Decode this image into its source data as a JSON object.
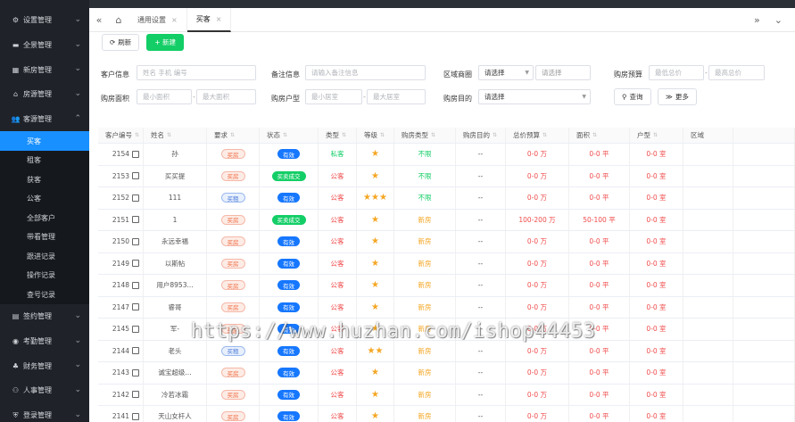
{
  "sidebar": {
    "menus": [
      {
        "label": "设置管理",
        "icon": "gear-icon"
      },
      {
        "label": "全景管理",
        "icon": "panorama-icon"
      },
      {
        "label": "新房管理",
        "icon": "building-icon"
      },
      {
        "label": "房源管理",
        "icon": "home-icon"
      },
      {
        "label": "客源管理",
        "icon": "users-icon"
      }
    ],
    "submenu": [
      "买客",
      "租客",
      "获客",
      "公客",
      "全部客户",
      "带看管理",
      "跟进记录",
      "操作记录",
      "查号记录"
    ],
    "menus_bottom": [
      {
        "label": "签约管理",
        "icon": "contract-icon"
      },
      {
        "label": "考勤管理",
        "icon": "location-icon"
      },
      {
        "label": "财务管理",
        "icon": "finance-icon"
      },
      {
        "label": "人事管理",
        "icon": "org-icon"
      },
      {
        "label": "登录管理",
        "icon": "shield-icon"
      }
    ]
  },
  "tabs": [
    {
      "label": "通用设置",
      "close": "×"
    },
    {
      "label": "买客",
      "close": "×"
    }
  ],
  "toolbar": {
    "refresh_label": "刷新",
    "new_label": "+ 新建"
  },
  "filters": {
    "customer_info_label": "客户信息",
    "customer_info_placeholder": "姓名 手机 编号",
    "remark_label": "备注信息",
    "remark_placeholder": "请输入备注信息",
    "area_label": "区域商圈",
    "area_select1": "请选择",
    "area_select2": "请选择",
    "budget_label": "购房预算",
    "budget_min_placeholder": "最低总价",
    "budget_max_placeholder": "最高总价",
    "size_label": "购房面积",
    "size_min_placeholder": "最小面积",
    "size_max_placeholder": "最大面积",
    "layout_label": "购房户型",
    "layout_min_placeholder": "最小居室",
    "layout_max_placeholder": "最大居室",
    "purpose_label": "购房目的",
    "purpose_select": "请选择",
    "search_label": "查询",
    "more_label": "更多",
    "range_dash": "-"
  },
  "table": {
    "headers": [
      "客户编号",
      "姓名",
      "要求",
      "状态",
      "类型",
      "等级",
      "购房类型",
      "购房目的",
      "总价预算",
      "面积",
      "户型",
      "区域"
    ],
    "rows": [
      {
        "id": "2154",
        "name": "孙",
        "req": "买房",
        "req_type": "buy",
        "status": "有效",
        "status_type": "valid",
        "type": "私客",
        "type_class": "green",
        "stars": "★",
        "house_type": "不限",
        "house_class": "green",
        "purpose": "--",
        "budget": "0-0 万",
        "area": "0-0 平",
        "layout": "0-0 室",
        "region": ""
      },
      {
        "id": "2153",
        "name": "买买提",
        "req": "买房",
        "req_type": "buy",
        "status": "买卖成交",
        "status_type": "done",
        "type": "公客",
        "type_class": "red",
        "stars": "★",
        "house_type": "不限",
        "house_class": "green",
        "purpose": "--",
        "budget": "0-0 万",
        "area": "0-0 平",
        "layout": "0-0 室",
        "region": ""
      },
      {
        "id": "2152",
        "name": "111",
        "req": "买租",
        "req_type": "rent",
        "status": "有效",
        "status_type": "valid",
        "type": "公客",
        "type_class": "red",
        "stars": "★★★",
        "house_type": "不限",
        "house_class": "green",
        "purpose": "--",
        "budget": "0-0 万",
        "area": "0-0 平",
        "layout": "0-0 室",
        "region": ""
      },
      {
        "id": "2151",
        "name": "1",
        "req": "买房",
        "req_type": "buy",
        "status": "买卖成交",
        "status_type": "done",
        "type": "公客",
        "type_class": "red",
        "stars": "★",
        "house_type": "新房",
        "house_class": "orange",
        "purpose": "--",
        "budget": "100-200 万",
        "area": "50-100 平",
        "layout": "0-0 室",
        "region": ""
      },
      {
        "id": "2150",
        "name": "永远幸福",
        "req": "买房",
        "req_type": "buy",
        "status": "有效",
        "status_type": "valid",
        "type": "公客",
        "type_class": "red",
        "stars": "★",
        "house_type": "新房",
        "house_class": "orange",
        "purpose": "--",
        "budget": "0-0 万",
        "area": "0-0 平",
        "layout": "0-0 室",
        "region": ""
      },
      {
        "id": "2149",
        "name": "以斯帖",
        "req": "买房",
        "req_type": "buy",
        "status": "有效",
        "status_type": "valid",
        "type": "公客",
        "type_class": "red",
        "stars": "★",
        "house_type": "新房",
        "house_class": "orange",
        "purpose": "--",
        "budget": "0-0 万",
        "area": "0-0 平",
        "layout": "0-0 室",
        "region": ""
      },
      {
        "id": "2148",
        "name": "用户8953...",
        "req": "买房",
        "req_type": "buy",
        "status": "有效",
        "status_type": "valid",
        "type": "公客",
        "type_class": "red",
        "stars": "★",
        "house_type": "新房",
        "house_class": "orange",
        "purpose": "--",
        "budget": "0-0 万",
        "area": "0-0 平",
        "layout": "0-0 室",
        "region": ""
      },
      {
        "id": "2147",
        "name": "睿哥",
        "req": "买房",
        "req_type": "buy",
        "status": "有效",
        "status_type": "valid",
        "type": "公客",
        "type_class": "red",
        "stars": "★",
        "house_type": "新房",
        "house_class": "orange",
        "purpose": "--",
        "budget": "0-0 万",
        "area": "0-0 平",
        "layout": "0-0 室",
        "region": ""
      },
      {
        "id": "2145",
        "name": "军-",
        "req": "买房",
        "req_type": "buy",
        "status": "有效",
        "status_type": "valid",
        "type": "公客",
        "type_class": "red",
        "stars": "★",
        "house_type": "新房",
        "house_class": "orange",
        "purpose": "--",
        "budget": "0-0 万",
        "area": "0-0 平",
        "layout": "0-0 室",
        "region": ""
      },
      {
        "id": "2144",
        "name": "老头",
        "req": "买租",
        "req_type": "rent",
        "status": "有效",
        "status_type": "valid",
        "type": "公客",
        "type_class": "red",
        "stars": "★★",
        "house_type": "新房",
        "house_class": "orange",
        "purpose": "--",
        "budget": "0-0 万",
        "area": "0-0 平",
        "layout": "0-0 室",
        "region": ""
      },
      {
        "id": "2143",
        "name": "诚宝超级...",
        "req": "买房",
        "req_type": "buy",
        "status": "有效",
        "status_type": "valid",
        "type": "公客",
        "type_class": "red",
        "stars": "★",
        "house_type": "新房",
        "house_class": "orange",
        "purpose": "--",
        "budget": "0-0 万",
        "area": "0-0 平",
        "layout": "0-0 室",
        "region": ""
      },
      {
        "id": "2142",
        "name": "冷若冰霜",
        "req": "买房",
        "req_type": "buy",
        "status": "有效",
        "status_type": "valid",
        "type": "公客",
        "type_class": "red",
        "stars": "★",
        "house_type": "新房",
        "house_class": "orange",
        "purpose": "--",
        "budget": "0-0 万",
        "area": "0-0 平",
        "layout": "0-0 室",
        "region": ""
      },
      {
        "id": "2141",
        "name": "天山女杆人",
        "req": "买房",
        "req_type": "buy",
        "status": "有效",
        "status_type": "valid",
        "type": "公客",
        "type_class": "red",
        "stars": "★",
        "house_type": "新房",
        "house_class": "orange",
        "purpose": "--",
        "budget": "0-0 万",
        "area": "0-0 平",
        "layout": "0-0 室",
        "region": ""
      }
    ]
  },
  "watermark": "https://www.huzhan.com/ishop44453",
  "colors": {
    "accent": "#1890ff",
    "green": "#13ce66",
    "red": "#f04c4c",
    "star": "#f5a623",
    "sidebar": "#1f2329"
  }
}
